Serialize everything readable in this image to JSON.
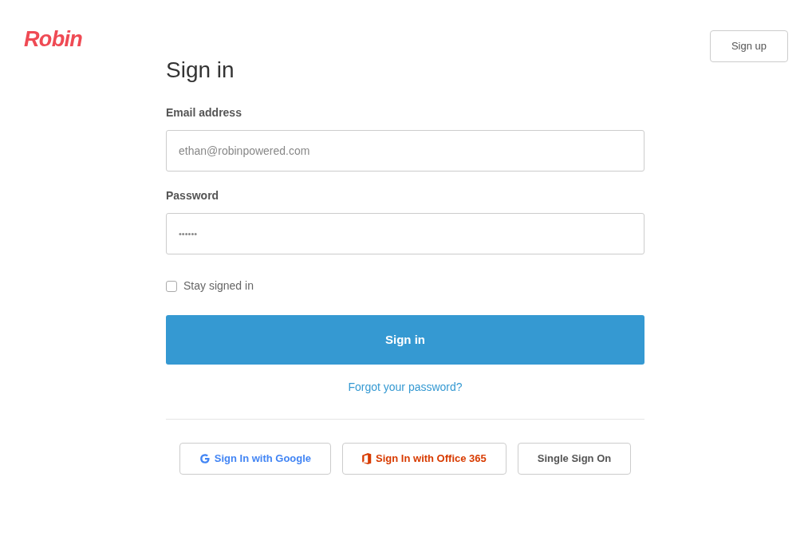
{
  "header": {
    "logo": "Robin",
    "signup_button": "Sign up"
  },
  "form": {
    "title": "Sign in",
    "email": {
      "label": "Email address",
      "placeholder": "ethan@robinpowered.com"
    },
    "password": {
      "label": "Password",
      "value": "••••••"
    },
    "stay_signed_in": {
      "label": "Stay signed in",
      "checked": false
    },
    "submit": "Sign in",
    "forgot_link": "Forgot your password?",
    "social_buttons": [
      {
        "kind": "google",
        "label": "Sign In with Google"
      },
      {
        "kind": "office",
        "label": "Sign In with Office 365"
      },
      {
        "kind": "sso",
        "label": "Single Sign On"
      }
    ]
  }
}
